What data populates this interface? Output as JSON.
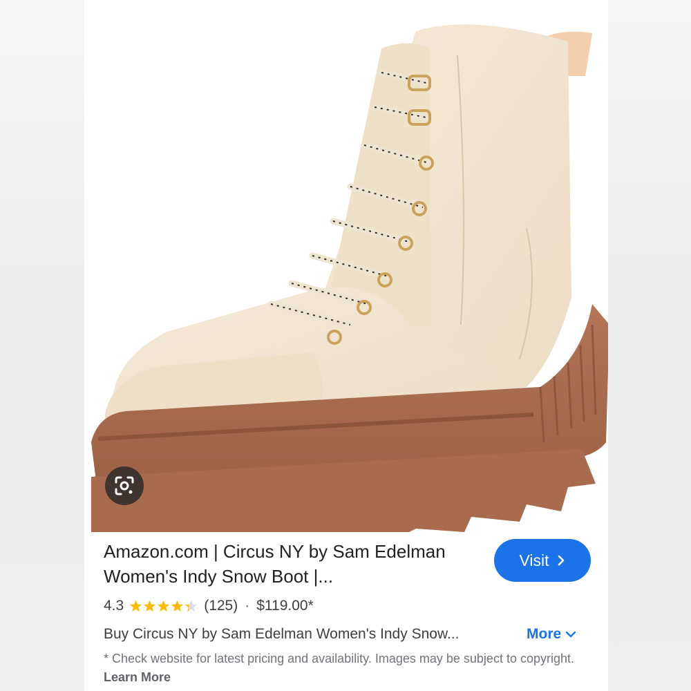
{
  "result": {
    "title": "Amazon.com | Circus NY by Sam Edelman Women's Indy Snow Boot |...",
    "visit_label": "Visit",
    "rating": "4.3",
    "stars_filled": 4.3,
    "review_count": "(125)",
    "separator": "·",
    "price": "$119.00*",
    "description": "Buy Circus NY by Sam Edelman Women's Indy Snow...",
    "more_label": "More",
    "disclaimer": "* Check website for latest pricing and availability. Images may be subject to copyright.",
    "learn_more_label": "Learn More"
  },
  "icons": {
    "lens": "google-lens-icon",
    "visit_chevron": "chevron-right-icon",
    "more_chevron": "chevron-down-icon"
  },
  "colors": {
    "accent": "#1a73e8",
    "star": "#fbbc04",
    "star_empty": "#dadce0",
    "boot_upper": "#f1e3cf",
    "boot_sole": "#a86b4e"
  }
}
